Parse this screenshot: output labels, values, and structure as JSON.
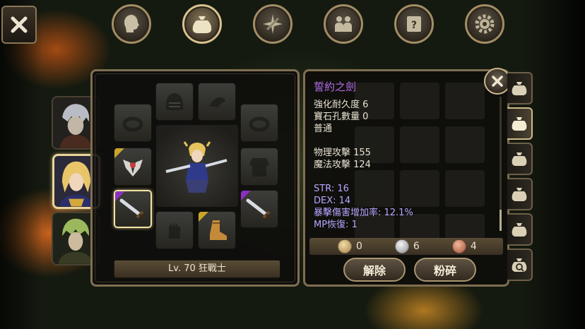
{
  "top_nav": [
    {
      "name": "character",
      "icon": "head-icon",
      "active": false
    },
    {
      "name": "bag",
      "icon": "bag-icon",
      "active": true
    },
    {
      "name": "skills",
      "icon": "sword-burst-icon",
      "active": false
    },
    {
      "name": "party",
      "icon": "people-icon",
      "active": false
    },
    {
      "name": "quest",
      "icon": "scroll-icon",
      "active": false
    },
    {
      "name": "settings",
      "icon": "gear-icon",
      "active": false
    }
  ],
  "equipment": {
    "level_label": "Lv. 70 狂戰士",
    "slot_marks": {
      "amulet": "#c9a52a",
      "weapon_left": "#8a2fbf",
      "weapon_right": "#8a2fbf",
      "boots": "#c9a52a"
    }
  },
  "item": {
    "name": "誓約之劍",
    "lines": [
      "強化耐久度 6",
      "寶石孔數量 0",
      "普通"
    ],
    "attack_lines": [
      "物理攻擊 155",
      "魔法攻擊 124"
    ],
    "stat_lines": [
      "STR: 16",
      "DEX: 14",
      "暴擊傷害增加率: 12.1%",
      "MP恢復: 1"
    ],
    "name_color": "#b46ee8",
    "stat_color": "#b8a6ff"
  },
  "currency": {
    "gold": "0",
    "silver": "6",
    "copper": "4"
  },
  "buttons": {
    "unequip": "解除",
    "shatter": "粉碎"
  }
}
